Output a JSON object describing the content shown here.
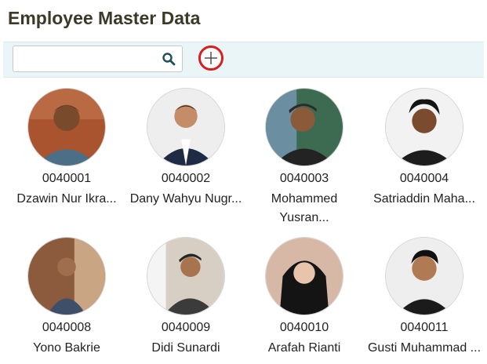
{
  "header": {
    "title": "Employee Master Data"
  },
  "toolbar": {
    "search_value": "",
    "search_placeholder": ""
  },
  "colors": {
    "accent": "#d81e1e",
    "toolbar_bg": "#e9f5f7",
    "title": "#3b3a28"
  },
  "employees": [
    {
      "id": "0040001",
      "name": "Dzawin Nur Ikra..."
    },
    {
      "id": "0040002",
      "name": "Dany Wahyu Nugr..."
    },
    {
      "id": "0040003",
      "name": "Mohammed Yusran..."
    },
    {
      "id": "0040004",
      "name": "Satriaddin Maha..."
    },
    {
      "id": "0040008",
      "name": "Yono Bakrie"
    },
    {
      "id": "0040009",
      "name": "Didi Sunardi"
    },
    {
      "id": "0040010",
      "name": "Arafah Rianti"
    },
    {
      "id": "0040011",
      "name": "Gusti Muhammad ..."
    }
  ]
}
